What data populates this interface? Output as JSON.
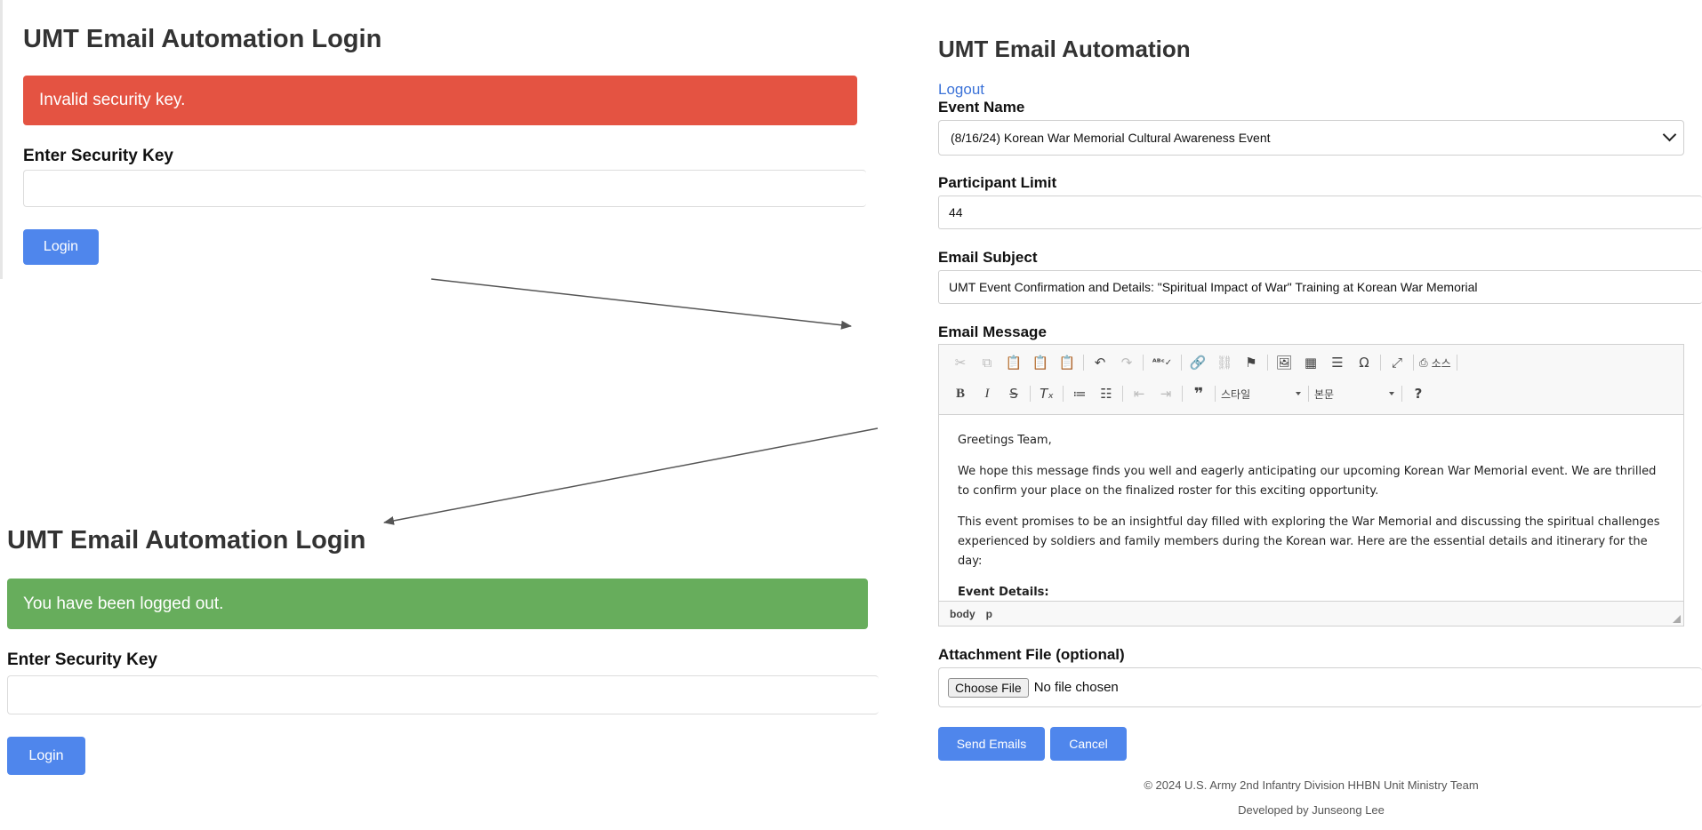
{
  "login_top": {
    "title": "UMT Email Automation Login",
    "alert": "Invalid security key.",
    "field_label": "Enter Security Key",
    "field_value": "",
    "login_button": "Login"
  },
  "login_bottom": {
    "title": "UMT Email Automation Login",
    "alert": "You have been logged out.",
    "field_label": "Enter Security Key",
    "field_value": "",
    "login_button": "Login"
  },
  "app": {
    "title": "UMT Email Automation",
    "logout": "Logout",
    "event_name_label": "Event Name",
    "event_name_value": "(8/16/24) Korean War Memorial Cultural Awareness Event",
    "participant_limit_label": "Participant Limit",
    "participant_limit_value": "44",
    "email_subject_label": "Email Subject",
    "email_subject_value": "UMT Event Confirmation and Details: \"Spiritual Impact of War\" Training at Korean War Memorial",
    "email_message_label": "Email Message",
    "editor": {
      "style_combo": "스타일",
      "format_combo": "본문",
      "source_label": "소스",
      "paragraphs": [
        "Greetings Team,",
        "We hope this message finds you well and eagerly anticipating our upcoming Korean War Memorial event. We are thrilled to confirm your place on the finalized roster for this exciting opportunity.",
        "This event promises to be an insightful day filled with exploring the War Memorial and discussing the spiritual challenges experienced by soldiers and family members during the Korean war. Here are the essential details and itinerary for the day:"
      ],
      "bold_heading": "Event Details:",
      "path": [
        "body",
        "p"
      ]
    },
    "attachment_label": "Attachment File (optional)",
    "choose_file_button": "Choose File",
    "no_file_text": "No file chosen",
    "send_button": "Send Emails",
    "cancel_button": "Cancel",
    "footer_copyright": "© 2024 U.S. Army 2nd Infantry Division HHBN Unit Ministry Team",
    "footer_developer": "Developed by Junseong Lee"
  },
  "colors": {
    "danger": "#e45342",
    "success": "#67ad5c",
    "primary": "#4f86ec",
    "link": "#3b72d8"
  }
}
